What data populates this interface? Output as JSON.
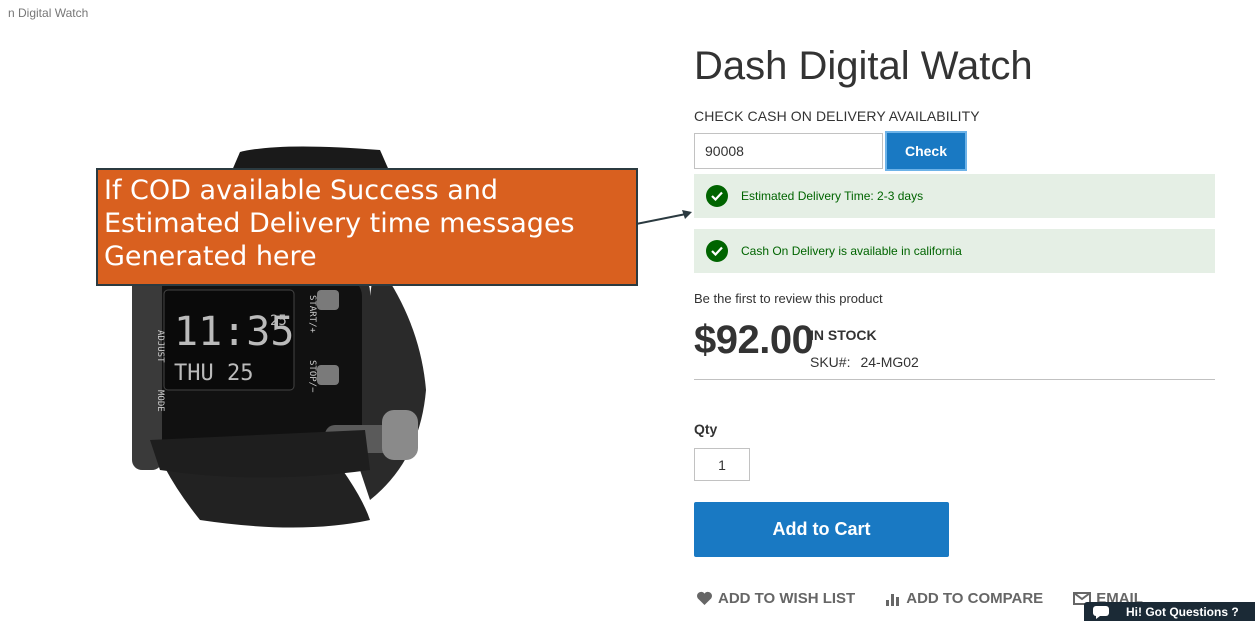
{
  "breadcrumb": {
    "current": "n Digital Watch"
  },
  "callout": {
    "text": "If COD available Success and Estimated Delivery time messages Generated here"
  },
  "product": {
    "title": "Dash Digital Watch",
    "watch_display": {
      "time": "11:35",
      "seconds": "25",
      "day": "THU 25",
      "left_label": "ADJUST",
      "mode_label": "MODE",
      "right_top": "START/+",
      "right_bottom": "STOP/−"
    },
    "review_prompt": "Be the first to review this product",
    "price": "$92.00",
    "stock": "IN STOCK",
    "sku_label": "SKU#:",
    "sku": "24-MG02"
  },
  "cod": {
    "label": "CHECK CASH ON DELIVERY AVAILABILITY",
    "zip_value": "90008",
    "check_label": "Check",
    "messages": [
      "Estimated Delivery Time: 2-3 days",
      "Cash On Delivery is available in california"
    ]
  },
  "qty": {
    "label": "Qty",
    "value": "1"
  },
  "add_to_cart": "Add to Cart",
  "actions": {
    "wishlist": "ADD TO WISH LIST",
    "compare": "ADD TO COMPARE",
    "email": "EMAIL"
  },
  "chat": {
    "text": "Hi! Got Questions ?"
  },
  "colors": {
    "primary": "#1979c3",
    "success_bg": "#e5efe5",
    "success_text": "#006400",
    "callout_bg": "#d9601f"
  }
}
